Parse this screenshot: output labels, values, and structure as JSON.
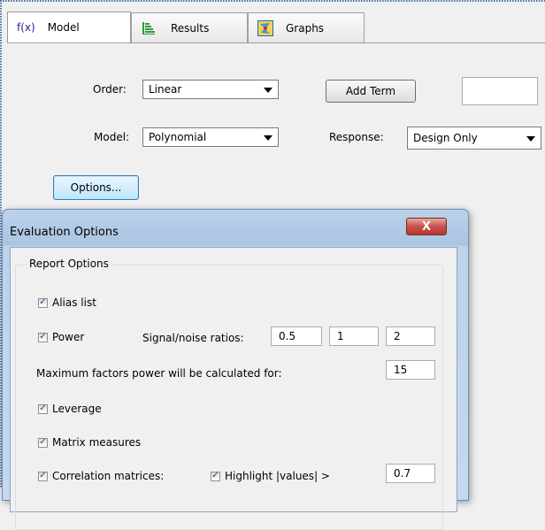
{
  "tabs": [
    {
      "label": "Model",
      "icon": "fx-icon",
      "icon_text": "f(x)"
    },
    {
      "label": "Results",
      "icon": "results-icon"
    },
    {
      "label": "Graphs",
      "icon": "graphs-icon"
    }
  ],
  "model_form": {
    "order_label": "Order:",
    "order_value": "Linear",
    "add_term_label": "Add Term",
    "add_term_value": "",
    "model_label": "Model:",
    "model_value": "Polynomial",
    "response_label": "Response:",
    "response_value": "Design Only",
    "options_button": "Options..."
  },
  "dialog": {
    "title": "Evaluation Options",
    "close_symbol": "X",
    "group_title": "Report Options",
    "alias_list": {
      "label": "Alias list",
      "checked": true
    },
    "power": {
      "label": "Power",
      "checked": true
    },
    "signal_noise_label": "Signal/noise ratios:",
    "signal_noise_values": [
      "0.5",
      "1",
      "2"
    ],
    "max_factors_label": "Maximum factors power will be calculated for:",
    "max_factors_value": "15",
    "leverage": {
      "label": "Leverage",
      "checked": true
    },
    "matrix_measures": {
      "label": "Matrix measures",
      "checked": true
    },
    "correlation_matrices": {
      "label": "Correlation matrices:",
      "checked": true
    },
    "highlight": {
      "label": "Highlight |values| >",
      "checked": true
    },
    "highlight_value": "0.7"
  },
  "colors": {
    "accent": "#3c7fb1",
    "close": "#c75050",
    "title_bar": "#bcd3ea"
  }
}
